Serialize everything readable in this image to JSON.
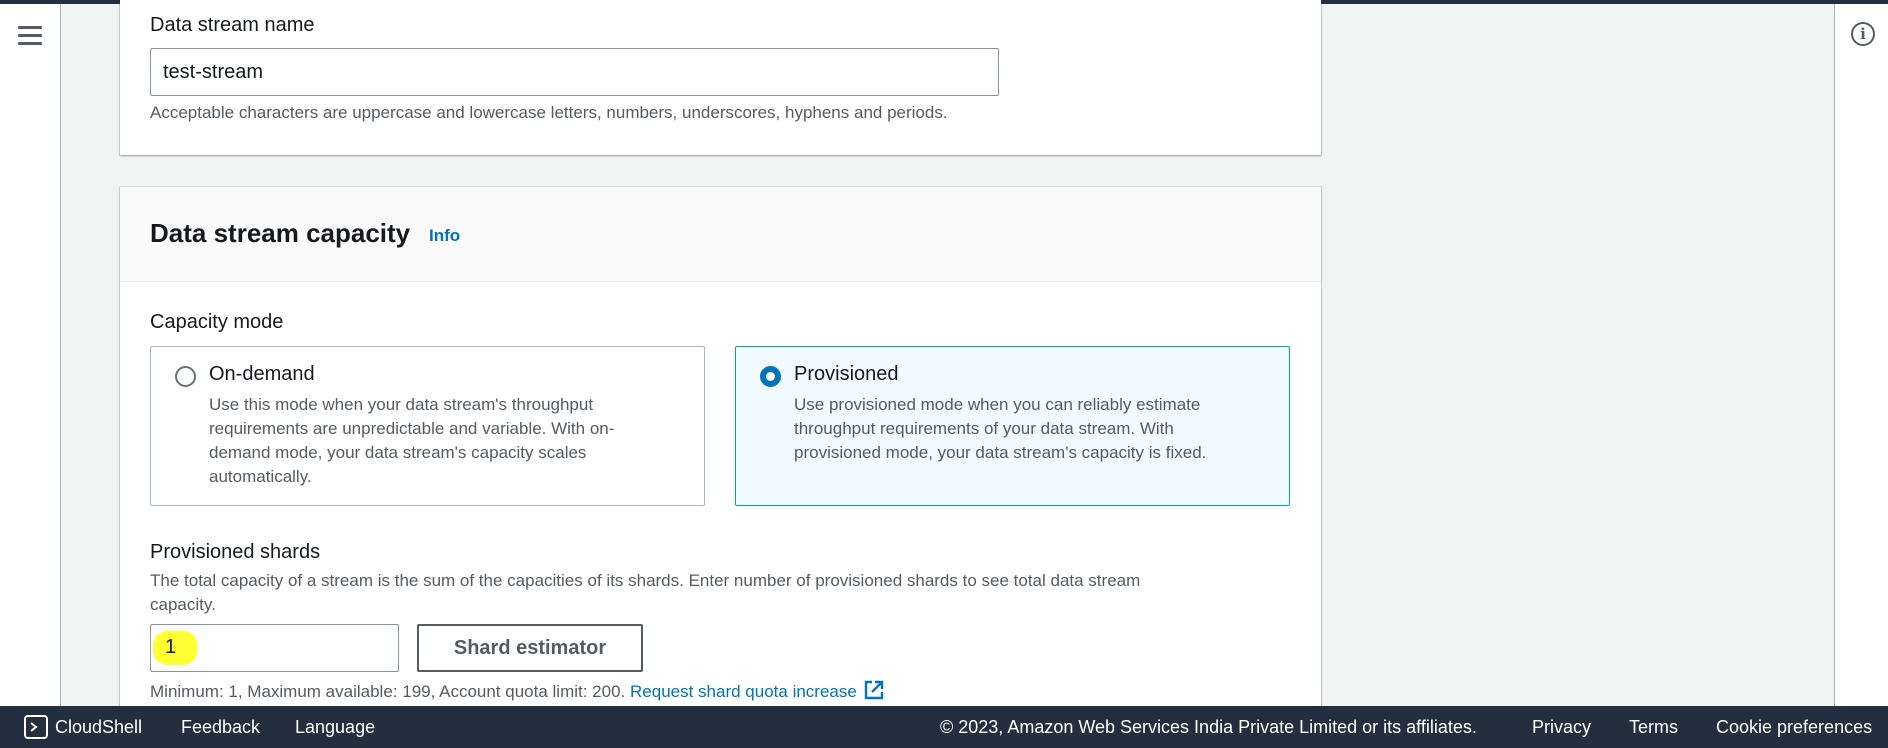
{
  "stream_name": {
    "label": "Data stream name",
    "value": "test-stream",
    "hint": "Acceptable characters are uppercase and lowercase letters, numbers, underscores, hyphens and periods."
  },
  "capacity": {
    "title": "Data stream capacity",
    "info_label": "Info",
    "mode_label": "Capacity mode",
    "options": [
      {
        "title": "On-demand",
        "selected": false,
        "desc_lines": [
          "Use this mode when your data stream's throughput",
          "requirements are unpredictable and variable. With on-",
          "demand mode, your data stream's capacity scales",
          "automatically."
        ]
      },
      {
        "title": "Provisioned",
        "selected": true,
        "desc_lines": [
          "Use provisioned mode when you can reliably estimate",
          "throughput requirements of your data stream. With",
          "provisioned mode, your data stream's capacity is fixed."
        ]
      }
    ],
    "shards_label": "Provisioned shards",
    "shards_desc_lines": [
      "The total capacity of a stream is the sum of the capacities of its shards. Enter number of provisioned shards to see total data stream",
      "capacity."
    ],
    "shards_value": "1",
    "estimator_button": "Shard estimator",
    "quota_text": "Minimum: 1, Maximum available: 199, Account quota limit: 200.",
    "quota_link": "Request shard quota increase"
  },
  "footer": {
    "cloudshell": "CloudShell",
    "feedback": "Feedback",
    "language": "Language",
    "copyright": "© 2023, Amazon Web Services India Private Limited or its affiliates.",
    "privacy": "Privacy",
    "terms": "Terms",
    "cookie": "Cookie preferences"
  },
  "icons": {
    "menu": "hamburger-menu-icon",
    "info": "info-icon",
    "external_link": "external-link-icon",
    "cloudshell": "terminal-icon"
  },
  "colors": {
    "accent": "#0073bb",
    "selected_border": "#00a1c9",
    "selected_bg": "#f1faff",
    "footer_bg": "#232f3e",
    "highlight": "#ffff33"
  }
}
